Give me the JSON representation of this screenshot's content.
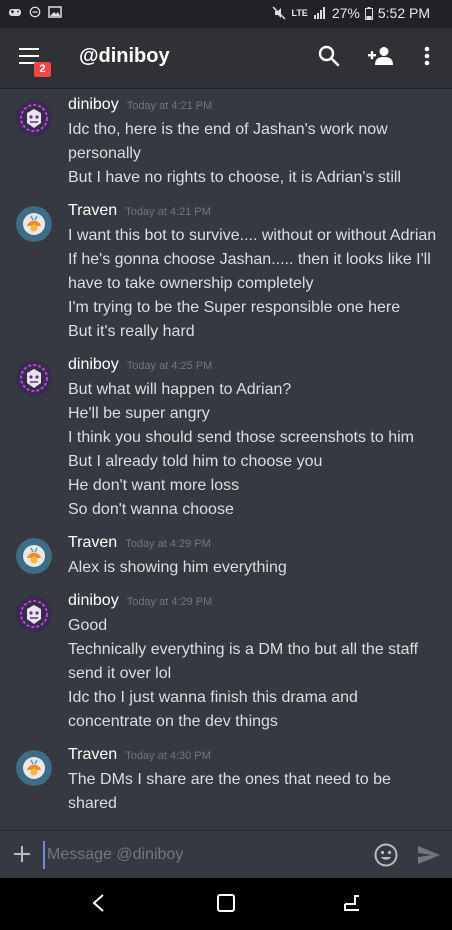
{
  "status_bar": {
    "left_icons": [
      "gamepad-icon",
      "minus-circle-icon",
      "image-icon"
    ],
    "network": "LTE",
    "battery": "27%",
    "time": "5:52 PM"
  },
  "header": {
    "title": "@diniboy",
    "notification_count": "2"
  },
  "messages": [
    {
      "author": "diniboy",
      "timestamp": "Today at 4:21 PM",
      "lines": [
        "Idc tho, here is the end of Jashan's work now personally",
        "But I have no rights to choose, it is Adrian's still"
      ]
    },
    {
      "author": "Traven",
      "timestamp": "Today at 4:21 PM",
      "lines": [
        "I want this bot to survive.... without or without Adrian",
        "If he's gonna choose Jashan..... then it looks like I'll have to take ownership completely",
        "I'm trying to be the Super responsible one here",
        "But it's really hard"
      ]
    },
    {
      "author": "diniboy",
      "timestamp": "Today at 4:25 PM",
      "lines": [
        "But what will happen to Adrian?",
        "He'll be super angry",
        "I think you should send those screenshots to him",
        "But I already told him to choose you",
        "He don't want more loss",
        "So don't wanna choose"
      ]
    },
    {
      "author": "Traven",
      "timestamp": "Today at 4:29 PM",
      "lines": [
        "Alex is showing him everything"
      ]
    },
    {
      "author": "diniboy",
      "timestamp": "Today at 4:29 PM",
      "lines": [
        "Good",
        "Technically everything is a DM tho but all the staff send it over lol",
        "Idc tho I just wanna finish this drama and concentrate on the dev things"
      ]
    },
    {
      "author": "Traven",
      "timestamp": "Today at 4:30 PM",
      "lines": [
        "The DMs I share are the ones that need to be shared"
      ]
    }
  ],
  "input": {
    "placeholder": "Message @diniboy",
    "value": ""
  },
  "colors": {
    "background": "#36393f",
    "header": "#2f3136",
    "badge": "#f04747",
    "timestamp": "#72767d",
    "accent": "#7289da"
  }
}
